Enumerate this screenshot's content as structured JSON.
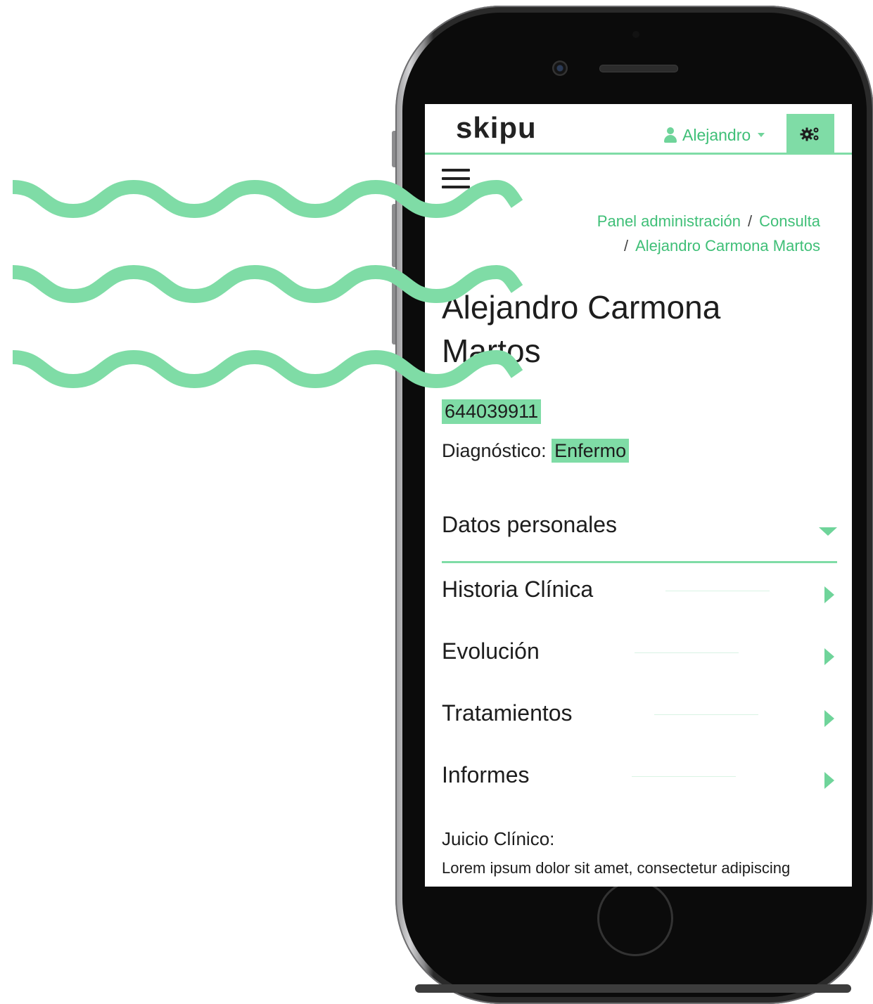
{
  "header": {
    "brand": "skipu",
    "user_name": "Alejandro"
  },
  "breadcrumb": {
    "items": [
      "Panel administración",
      "Consulta",
      "Alejandro Carmona Martos"
    ]
  },
  "patient": {
    "name": "Alejandro Carmona Martos",
    "phone": "644039911",
    "diagnosis_label": "Diagnóstico:",
    "diagnosis_value": "Enfermo"
  },
  "sections": [
    {
      "title": "Datos personales",
      "expanded": true
    },
    {
      "title": "Historia Clínica",
      "expanded": false
    },
    {
      "title": "Evolución",
      "expanded": false
    },
    {
      "title": "Tratamientos",
      "expanded": false
    },
    {
      "title": "Informes",
      "expanded": false
    }
  ],
  "juicio": {
    "label": "Juicio Clínico:",
    "text": "Lorem ipsum dolor sit amet, consectetur adipiscing"
  },
  "colors": {
    "accent": "#7fdca6",
    "accent_text": "#3fbf77",
    "text": "#1d1d1d"
  }
}
